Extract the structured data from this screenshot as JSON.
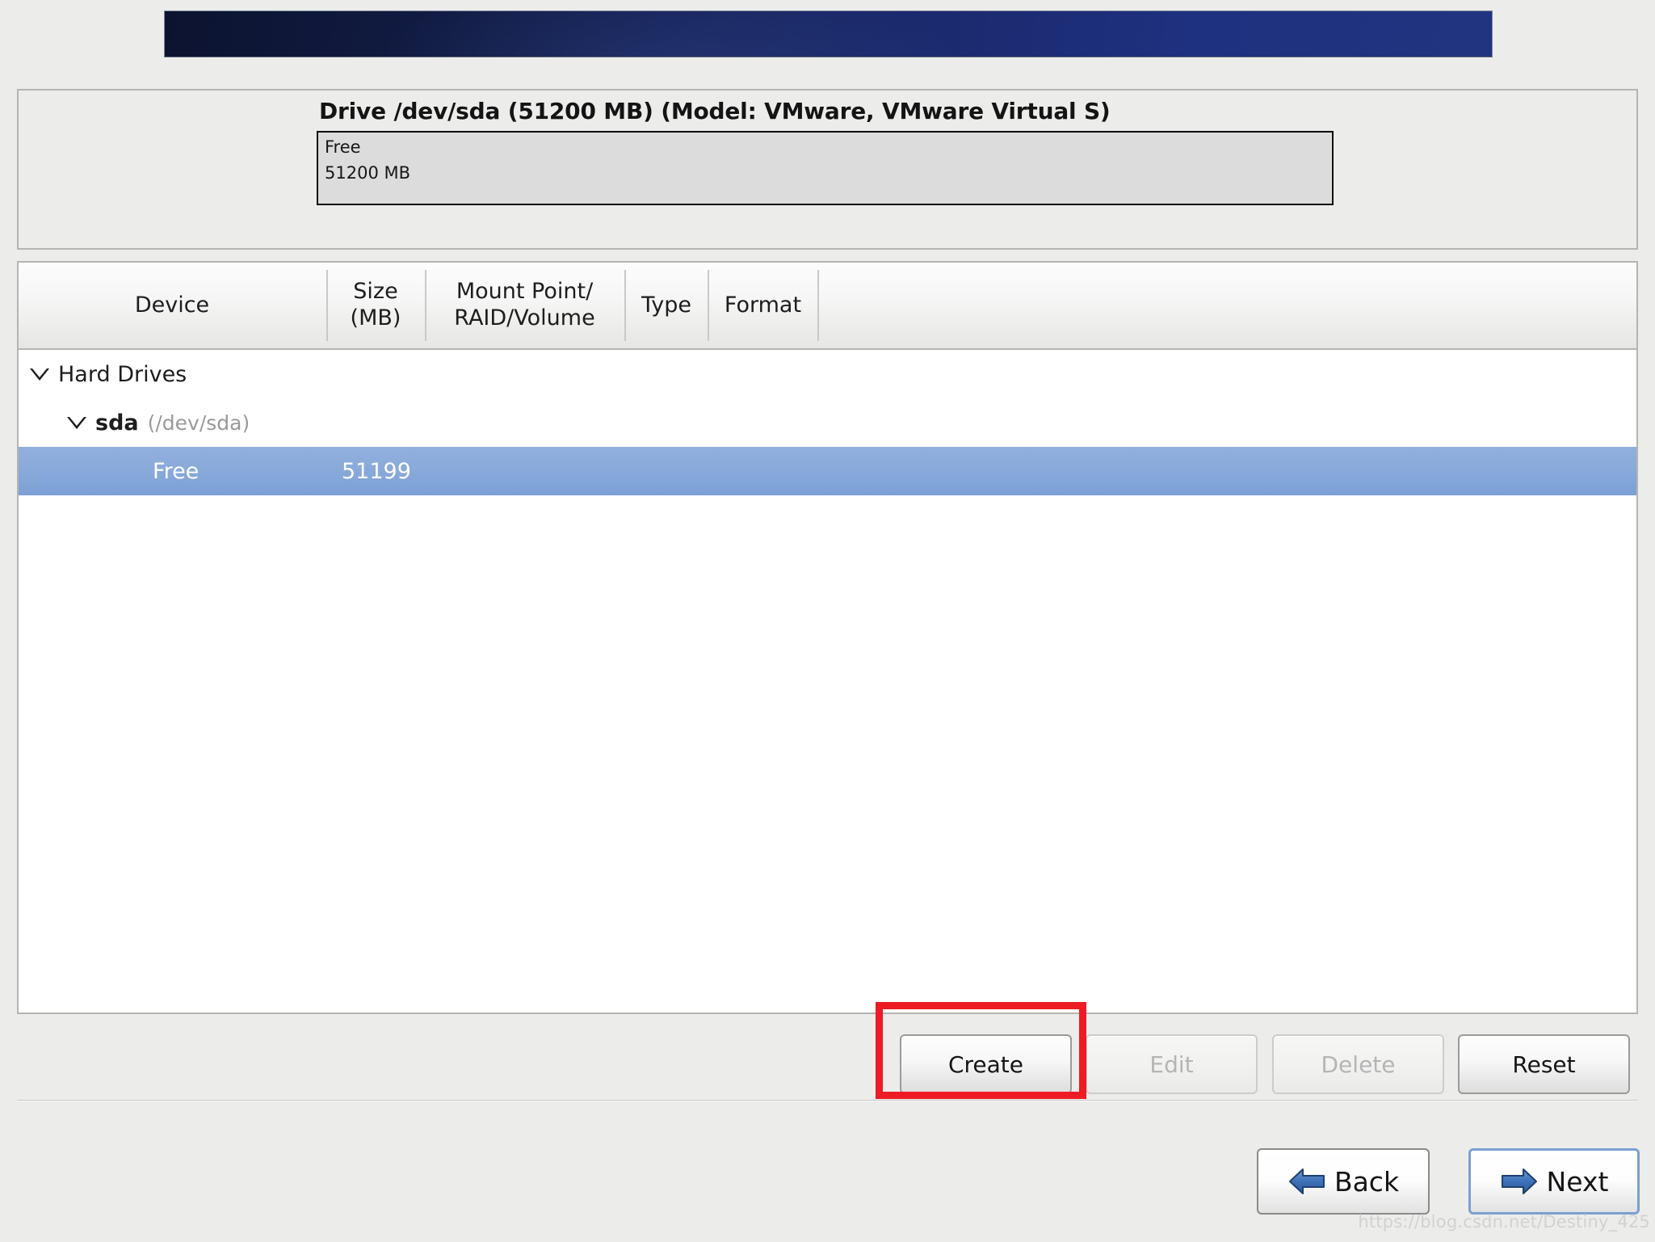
{
  "app": {
    "title": "Anaconda Installer - Partitioning",
    "banner_icon": "brand-banner"
  },
  "drive": {
    "title": "Drive /dev/sda (51200 MB) (Model: VMware, VMware Virtual S)",
    "segments": [
      {
        "name": "Free",
        "size_label": "51200 MB",
        "width_percent": 100
      }
    ]
  },
  "table": {
    "columns": [
      {
        "key": "device",
        "label": "Device"
      },
      {
        "key": "size",
        "label": "Size\n(MB)",
        "line1": "Size",
        "line2": "(MB)"
      },
      {
        "key": "mount",
        "label": "Mount Point/\nRAID/Volume",
        "line1": "Mount Point/",
        "line2": "RAID/Volume"
      },
      {
        "key": "type",
        "label": "Type"
      },
      {
        "key": "format",
        "label": "Format"
      }
    ],
    "rows": [
      {
        "name": "Hard Drives",
        "sub": "",
        "size": "",
        "mount": "",
        "type": "",
        "format": "",
        "level": 0,
        "expander": "triangle-down-icon",
        "selected": false
      },
      {
        "name": "sda",
        "sub": "(/dev/sda)",
        "size": "",
        "mount": "",
        "type": "",
        "format": "",
        "level": 1,
        "expander": "triangle-down-icon",
        "selected": false
      },
      {
        "name": "Free",
        "sub": "",
        "size": "51199",
        "mount": "",
        "type": "",
        "format": "",
        "level": 2,
        "expander": "",
        "selected": true
      }
    ]
  },
  "actions": {
    "create": {
      "label": "Create",
      "enabled": true,
      "highlighted": true
    },
    "edit": {
      "label": "Edit",
      "enabled": false
    },
    "delete": {
      "label": "Delete",
      "enabled": false
    },
    "reset": {
      "label": "Reset",
      "enabled": true
    }
  },
  "nav": {
    "back": {
      "label": "Back",
      "icon": "arrow-left-icon"
    },
    "next": {
      "label": "Next",
      "icon": "arrow-right-icon",
      "focused": true
    }
  },
  "watermark": "https://blog.csdn.net/Destiny_425",
  "colors": {
    "background": "#ececeb",
    "selection_blue": "#88a9da",
    "banner_dark": "#0c1330",
    "banner_light": "#20347f",
    "annotation_red": "#ed1c24",
    "disabled_text": "#b5b5b5",
    "panel_border": "#b4b4b2"
  }
}
